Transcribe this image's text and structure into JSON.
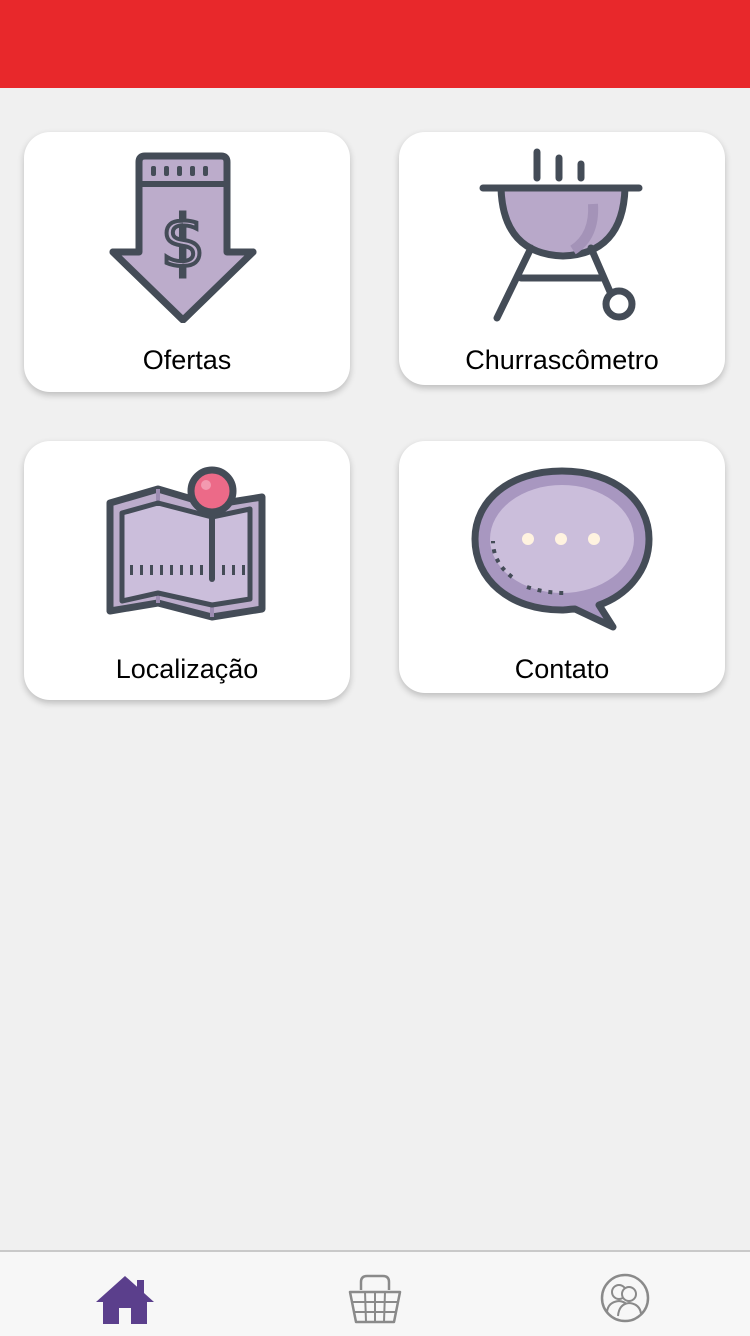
{
  "header": {
    "color": "#e8282b"
  },
  "menu": {
    "items": [
      {
        "id": "ofertas",
        "label": "Ofertas",
        "icon": "price-drop-icon"
      },
      {
        "id": "churrascometro",
        "label": "Churrascômetro",
        "icon": "grill-icon"
      },
      {
        "id": "localizacao",
        "label": "Localização",
        "icon": "map-pin-icon"
      },
      {
        "id": "contato",
        "label": "Contato",
        "icon": "chat-bubble-icon"
      }
    ]
  },
  "tabbar": {
    "tabs": [
      {
        "id": "home",
        "icon": "home-icon",
        "active": true
      },
      {
        "id": "basket",
        "icon": "basket-icon",
        "active": false
      },
      {
        "id": "profile",
        "icon": "user-circle-icon",
        "active": false
      }
    ],
    "active_color": "#5b3f8c",
    "inactive_color": "#8a8a8a"
  }
}
